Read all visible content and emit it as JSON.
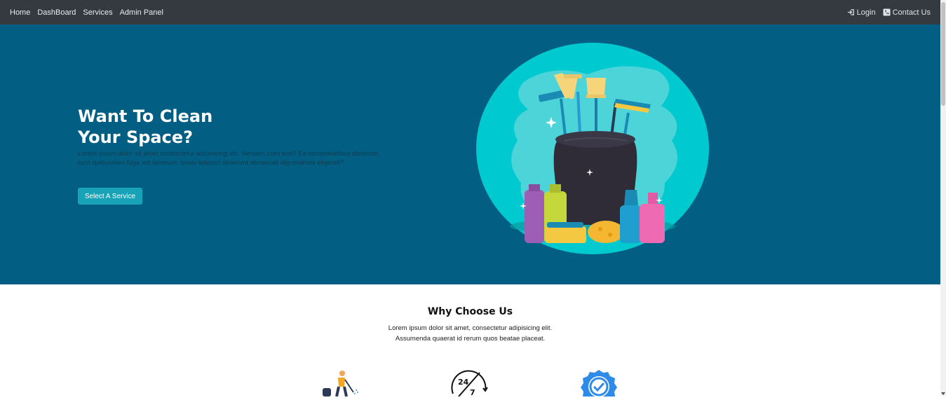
{
  "nav": {
    "left": [
      "Home",
      "DashBoard",
      "Services",
      "Admin Panel"
    ],
    "login": "Login",
    "contact": "Contact Us"
  },
  "hero": {
    "title_line1": "Want To Clean",
    "title_line2": "Your Space?",
    "text": "Lorem ipsum dolor sit amet consectetur adipisicing elit. Veniam, cum eos? Ea necessitatibus distinctio, sunt quibusdam fuga aut laborum, quasi adipisci deserunt obcaecati dignissimos eligendi?",
    "button": "Select A Service"
  },
  "why": {
    "title": "Why Choose Us",
    "sub_line1": "Lorem ipsum dolor sit amet, consectetur adipisicing elit.",
    "sub_line2": "Assumenda quaerat id rerum quos beatae placeat."
  },
  "badge_247": {
    "top": "24",
    "bottom": "7"
  },
  "icons": {
    "login": "sign-in-icon",
    "contact": "phone-square-icon",
    "feature1": "cleaner-vacuum-icon",
    "feature2": "24-7-clock-icon",
    "feature3": "verified-badge-icon"
  },
  "colors": {
    "navbar": "#343a40",
    "hero_bg": "#025e83",
    "button": "#17a2b8",
    "circle": "#00c9cf"
  }
}
